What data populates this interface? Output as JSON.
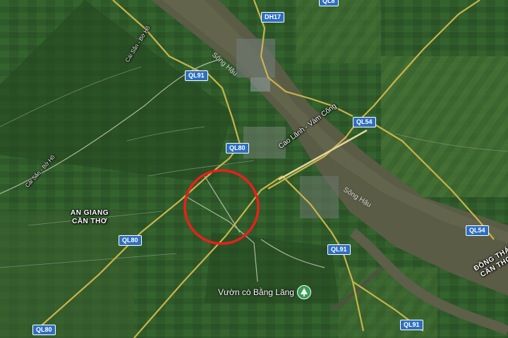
{
  "map": {
    "route_shields": [
      {
        "id": "dh17",
        "label": "DH17"
      },
      {
        "id": "ql91-top",
        "label": "QL91"
      },
      {
        "id": "ql80-mid",
        "label": "QL80"
      },
      {
        "id": "ql54-top",
        "label": "QL54"
      },
      {
        "id": "ql54-right",
        "label": "QL54"
      },
      {
        "id": "ql80-left",
        "label": "QL80"
      },
      {
        "id": "ql91-mid",
        "label": "QL91"
      },
      {
        "id": "ql80-bottom",
        "label": "QL80"
      },
      {
        "id": "ql91-bottom",
        "label": "QL91"
      },
      {
        "id": "ql-partial",
        "label": "QL8"
      }
    ],
    "river_labels": [
      "Sông Hậu",
      "Sông Hậu"
    ],
    "province_labels": {
      "left_top": "AN GIANG",
      "left_bottom": "CẦN THƠ",
      "right_top": "ĐỒNG THÁ",
      "right_bottom": "CẦN THƠ"
    },
    "road_label": "Cao Lãnh - Vàm Cống",
    "canal_labels": [
      "Cái Sắn - Bờ Hồ",
      "Cái Sắn - Bờ Hồ"
    ],
    "poi": {
      "name": "Vườn cò Bằng Lăng",
      "icon": "park-icon",
      "color": "#3a9d56"
    },
    "highlight": {
      "shape": "circle",
      "color": "#e8201c"
    }
  }
}
